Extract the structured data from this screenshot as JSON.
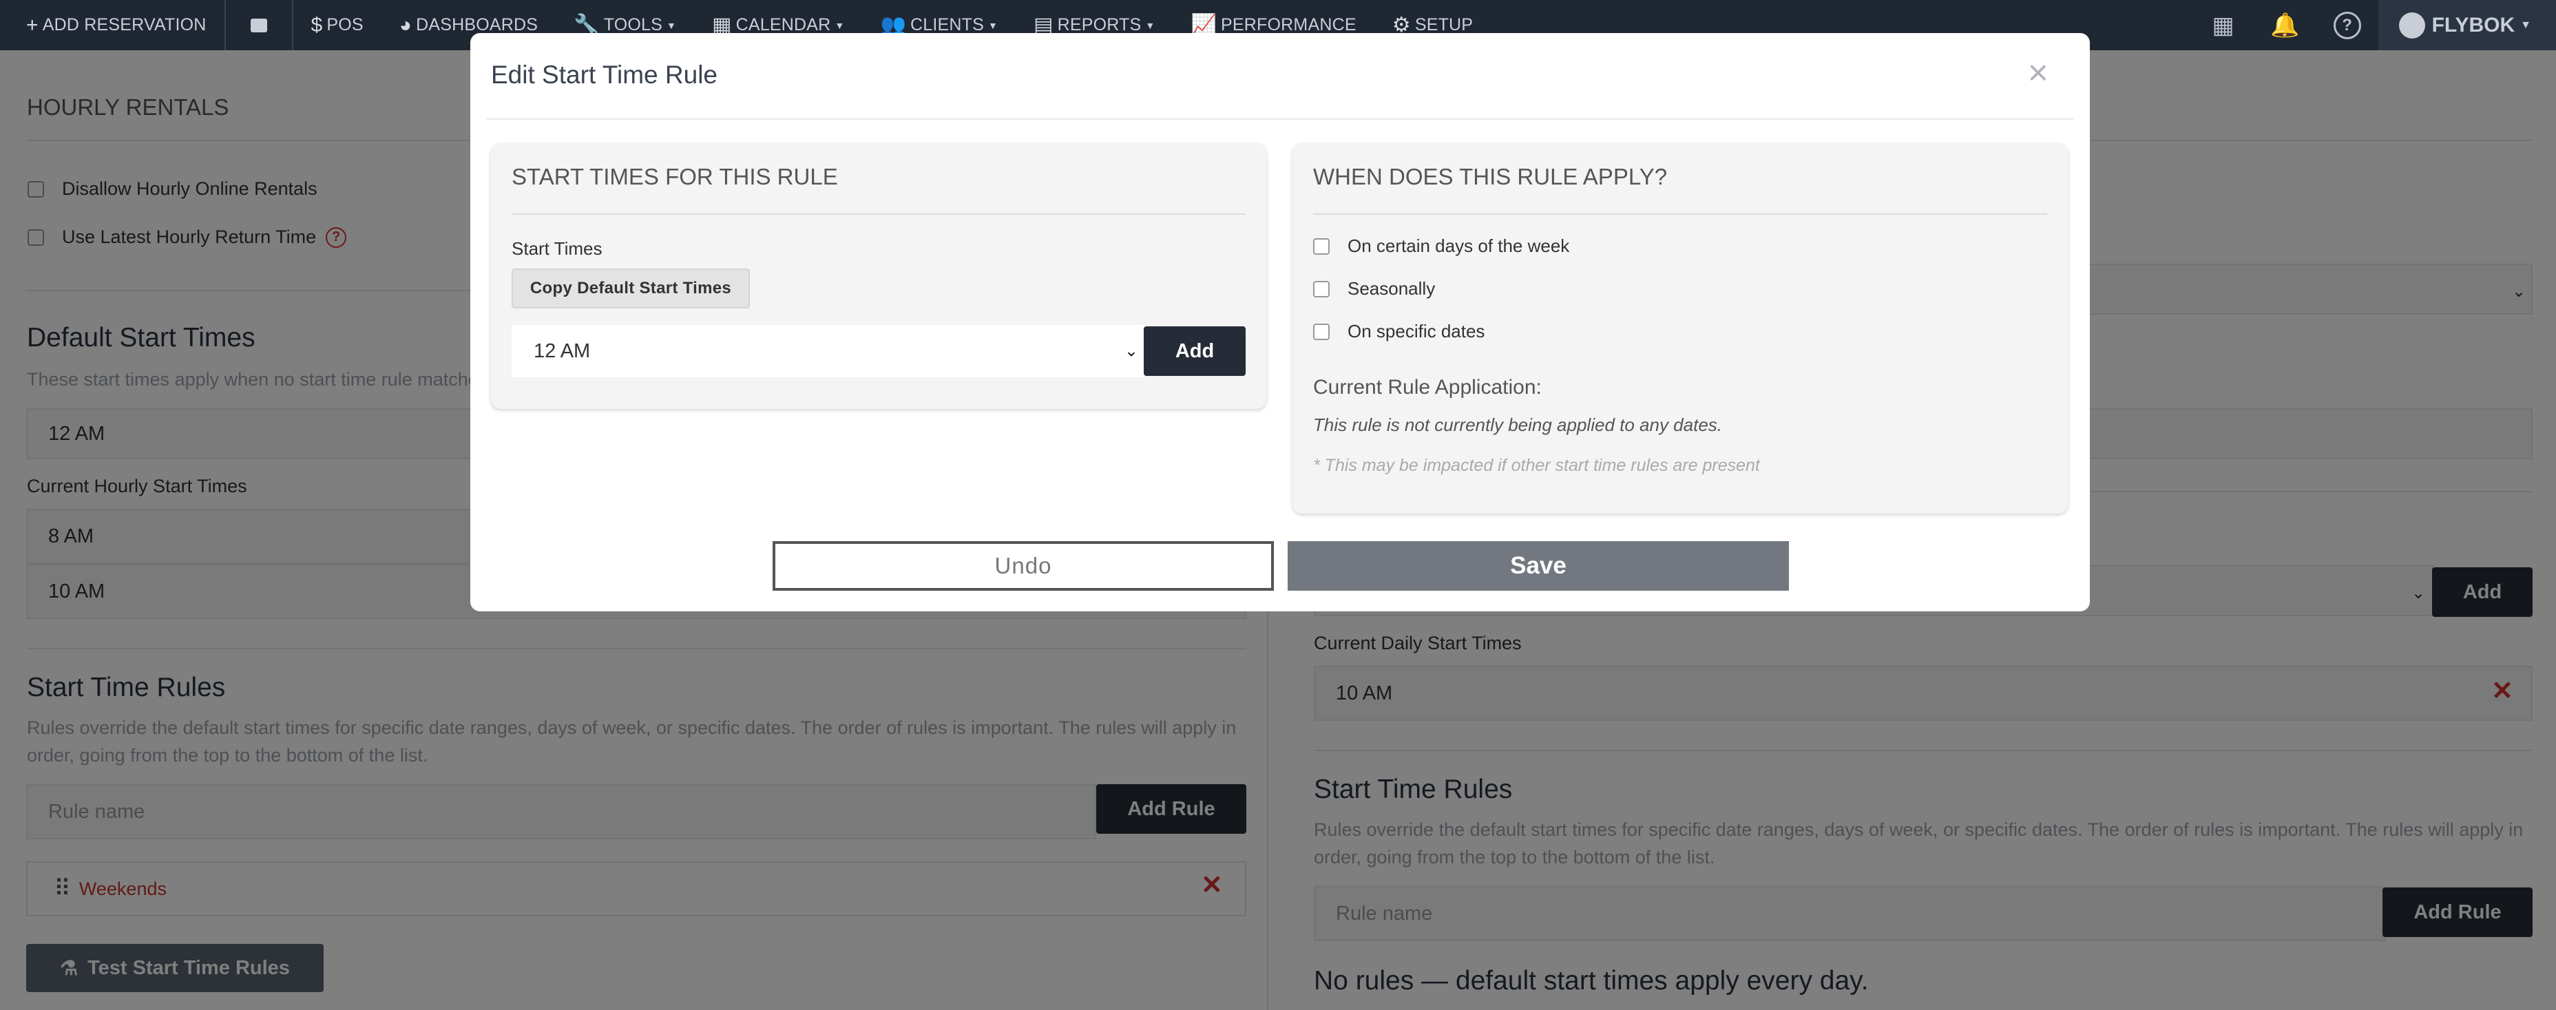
{
  "nav": {
    "add_reservation": "ADD RESERVATION",
    "pos": "POS",
    "dashboards": "DASHBOARDS",
    "tools": "TOOLS",
    "calendar": "CALENDAR",
    "clients": "CLIENTS",
    "reports": "REPORTS",
    "performance": "PERFORMANCE",
    "setup": "SETUP",
    "user": "FLYBOK"
  },
  "left": {
    "section_title": "HOURLY RENTALS",
    "disallow_label": "Disallow Hourly Online Rentals",
    "latest_return_label": "Use Latest Hourly Return Time",
    "default_heading": "Default Start Times",
    "default_desc": "These start times apply when no start time rule matches",
    "default_select_value": "12 AM",
    "current_label": "Current Hourly Start Times",
    "current_times": [
      "8 AM",
      "10 AM"
    ],
    "rules_heading": "Start Time Rules",
    "rules_desc_1": "Rules override the default start times for specific date ranges, days of week, or specific dates. The order of rules is important. The rules will apply in",
    "rules_desc_2": "order, going from the top to the bottom of the list.",
    "rule_name_placeholder": "Rule name",
    "add_rule": "Add Rule",
    "rules": [
      "Weekends"
    ],
    "test_button": "Test Start Time Rules"
  },
  "right": {
    "add_label": "Add",
    "current_label": "Current Daily Start Times",
    "current_times": [
      "10 AM"
    ],
    "rules_heading": "Start Time Rules",
    "rules_desc_1": "Rules override the default start times for specific date ranges, days of week, or specific dates. The order of rules is important. The rules will apply in",
    "rules_desc_2": "order, going from the top to the bottom of the list.",
    "rule_name_placeholder": "Rule name",
    "add_rule": "Add Rule",
    "no_rules": "No rules — default start times apply every day."
  },
  "modal": {
    "title": "Edit Start Time Rule",
    "close": "×",
    "left_panel": {
      "title": "START TIMES FOR THIS RULE",
      "start_times_label": "Start Times",
      "copy_button": "Copy Default Start Times",
      "select_value": "12 AM",
      "add_button": "Add"
    },
    "right_panel": {
      "title": "WHEN DOES THIS RULE APPLY?",
      "options": [
        "On certain days of the week",
        "Seasonally",
        "On specific dates"
      ],
      "current_heading": "Current Rule Application:",
      "current_text": "This rule is not currently being applied to any dates.",
      "note": "* This may be impacted if other start time rules are present"
    },
    "undo": "Undo",
    "save": "Save"
  }
}
